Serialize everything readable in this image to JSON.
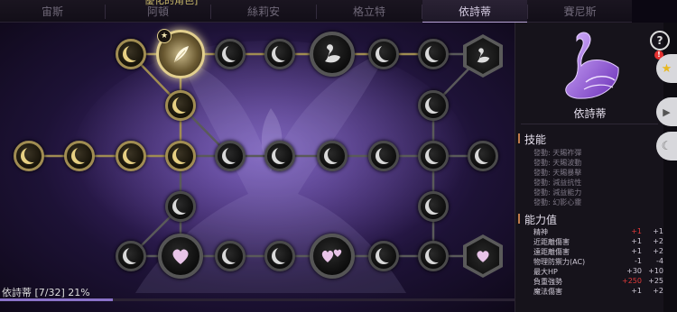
{
  "tabs": [
    {
      "label": "宙斯",
      "active": false
    },
    {
      "label": "阿頓",
      "active": false
    },
    {
      "label": "絲莉安",
      "active": false
    },
    {
      "label": "格立特",
      "active": false
    },
    {
      "label": "依詩蒂",
      "active": true
    },
    {
      "label": "賽尼斯",
      "active": false
    }
  ],
  "top_notice": "優化的角色]",
  "board": {
    "nodes": [
      {
        "id": "r1c1",
        "style": "gold",
        "icon": "moon-icon"
      },
      {
        "id": "r1c2-selected",
        "style": "selected",
        "icon": "feather-icon"
      },
      {
        "id": "r1c3",
        "style": "dark",
        "icon": "moon-icon"
      },
      {
        "id": "r1c4",
        "style": "dark",
        "icon": "moon-icon"
      },
      {
        "id": "r1c5",
        "style": "dark",
        "icon": "moon-icon"
      },
      {
        "id": "r1c6-large",
        "style": "dark",
        "icon": "swan-icon"
      },
      {
        "id": "r1c7",
        "style": "dark",
        "icon": "moon-icon"
      },
      {
        "id": "r1c8",
        "style": "dark",
        "icon": "moon-icon"
      },
      {
        "id": "r1c9-hex",
        "style": "hex",
        "icon": "swan-icon"
      }
    ],
    "progress": {
      "label": "依詩蒂 [7/32] 21%",
      "fraction": 0.21875
    }
  },
  "panel": {
    "character_name": "依詩蒂",
    "skills_heading": "技能",
    "skills": [
      "發動: 天賜祚彈",
      "發動: 天賜波動",
      "發動: 天賜暴擊",
      "發動: 減益抗性",
      "發動: 減益能力",
      "發動: 幻影心靈"
    ],
    "stats_heading": "能力值",
    "stats": [
      {
        "name": "精神",
        "a": "+1",
        "a_red": true,
        "b": "+1"
      },
      {
        "name": "近距離傷害",
        "a": "+1",
        "a_red": false,
        "b": "+2"
      },
      {
        "name": "遠距離傷害",
        "a": "+1",
        "a_red": false,
        "b": "+2"
      },
      {
        "name": "物理防禦力(AC)",
        "a": "-1",
        "a_red": false,
        "b": "-4"
      },
      {
        "name": "最大HP",
        "a": "+30",
        "a_red": false,
        "b": "+10"
      },
      {
        "name": "負重強勢",
        "a": "+250",
        "a_red": true,
        "b": "+25"
      },
      {
        "name": "魔法傷害",
        "a": "+1",
        "a_red": false,
        "b": "+2"
      }
    ]
  },
  "side_buttons": {
    "help": "?",
    "alert": "!"
  },
  "colors": {
    "accent": "#8a72c8",
    "gold": "#a08c52",
    "red": "#e23a3a"
  }
}
